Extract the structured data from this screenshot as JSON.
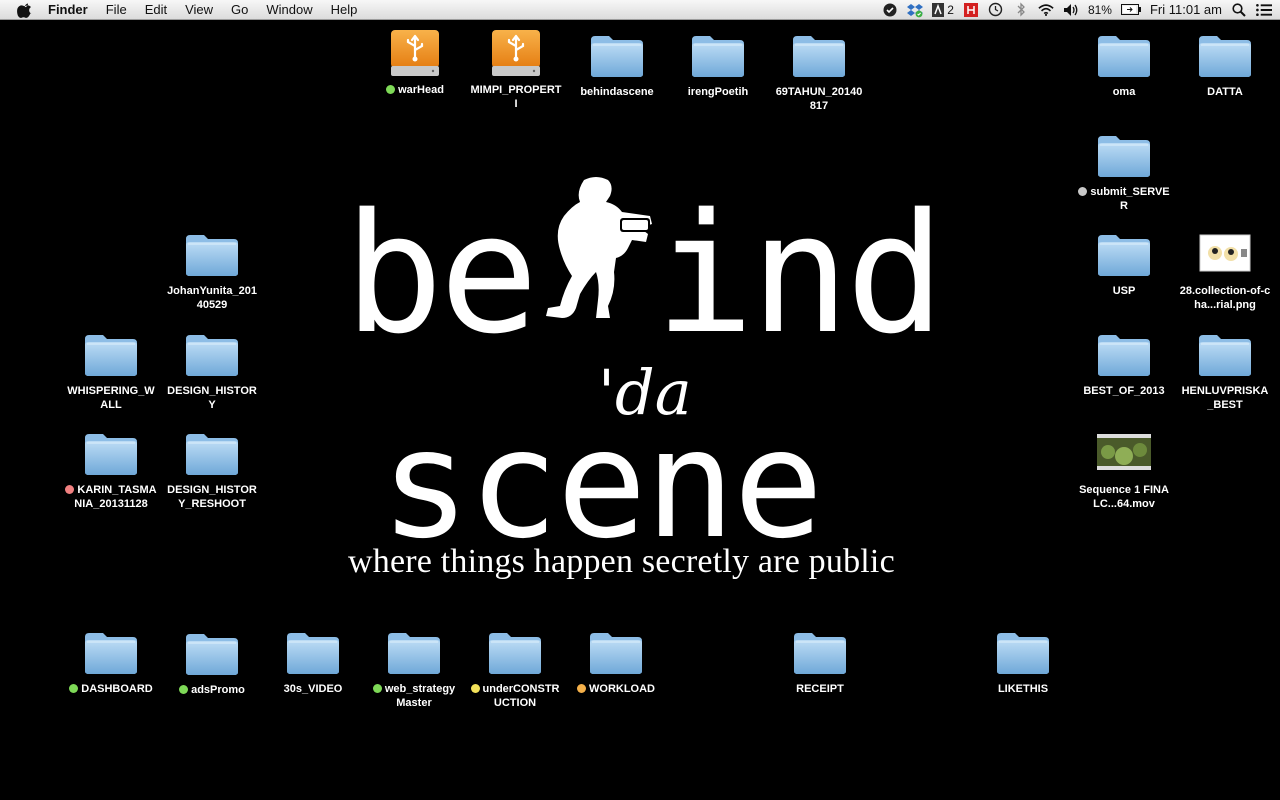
{
  "menubar": {
    "app": "Finder",
    "menus": [
      "File",
      "Edit",
      "View",
      "Go",
      "Window",
      "Help"
    ],
    "status": {
      "adobe_count": "2",
      "battery": "81%",
      "clock": "Fri 11:01 am"
    }
  },
  "wallpaper": {
    "word_left": "be",
    "word_right": "ind",
    "word_da": "'da",
    "word_scene": "scene",
    "tagline": "where things happen secretly are public"
  },
  "colors": {
    "tag_green": "#7ed957",
    "tag_yellow": "#f3e25a",
    "tag_orange": "#f4b04a",
    "tag_red": "#f08080",
    "tag_gray": "#c8c8c8",
    "folder_body": "#8fc0e6"
  },
  "desktop": {
    "warhead": {
      "label": "warHead",
      "tag": "green",
      "icon": "usb-drive-icon"
    },
    "mimpi": {
      "label": "MIMPI_PROPERTI",
      "tag": "",
      "icon": "usb-drive-icon"
    },
    "behindascene": {
      "label": "behindascene",
      "tag": "",
      "icon": "folder-icon"
    },
    "irengpoetih": {
      "label": "irengPoetih",
      "tag": "",
      "icon": "folder-icon"
    },
    "tahun69": {
      "label": "69TAHUN_20140817",
      "tag": "",
      "icon": "folder-icon"
    },
    "oma": {
      "label": "oma",
      "tag": "",
      "icon": "folder-icon"
    },
    "datta": {
      "label": "DATTA",
      "tag": "",
      "icon": "folder-icon"
    },
    "submit_server": {
      "label": "submit_SERVER",
      "tag": "gray",
      "icon": "folder-icon"
    },
    "usp": {
      "label": "USP",
      "tag": "",
      "icon": "folder-icon"
    },
    "collection": {
      "label": "28.collection-of-cha...rial.png",
      "tag": "",
      "icon": "image-file-icon"
    },
    "best2013": {
      "label": "BEST_OF_2013",
      "tag": "",
      "icon": "folder-icon"
    },
    "henluv": {
      "label": "HENLUVPRISKA_BEST",
      "tag": "",
      "icon": "folder-icon"
    },
    "sequence": {
      "label": "Sequence 1 FINALC...64.mov",
      "tag": "",
      "icon": "movie-file-icon"
    },
    "johanyunita": {
      "label": "JohanYunita_20140529",
      "tag": "",
      "icon": "folder-icon"
    },
    "whispering": {
      "label": "WHISPERING_WALL",
      "tag": "",
      "icon": "folder-icon"
    },
    "design_history": {
      "label": "DESIGN_HISTORY",
      "tag": "",
      "icon": "folder-icon"
    },
    "karin": {
      "label": "KARIN_TASMANIA_20131128",
      "tag": "red",
      "icon": "folder-icon"
    },
    "design_reshoot": {
      "label": "DESIGN_HISTORY_RESHOOT",
      "tag": "",
      "icon": "folder-icon"
    },
    "dashboard": {
      "label": "DASHBOARD",
      "tag": "green",
      "icon": "folder-icon"
    },
    "adspromo": {
      "label": "adsPromo",
      "tag": "green",
      "icon": "folder-icon"
    },
    "video30s": {
      "label": "30s_VIDEO",
      "tag": "",
      "icon": "folder-icon"
    },
    "web_strategy": {
      "label": "web_strategy Master",
      "tag": "green",
      "icon": "folder-icon"
    },
    "underconstruction": {
      "label": "underCONSTRUCTION",
      "tag": "yellow",
      "icon": "folder-icon"
    },
    "workload": {
      "label": "WORKLOAD",
      "tag": "orange",
      "icon": "folder-icon"
    },
    "receipt": {
      "label": "RECEIPT",
      "tag": "",
      "icon": "folder-icon"
    },
    "likethis": {
      "label": "LIKETHIS",
      "tag": "",
      "icon": "folder-icon"
    }
  }
}
